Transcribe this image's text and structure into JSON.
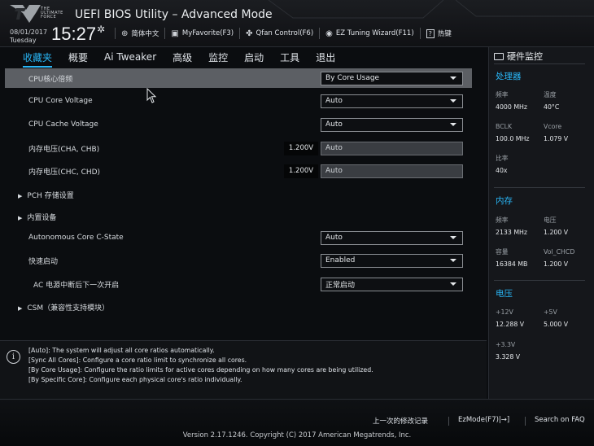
{
  "header": {
    "logo_text": "THE ULTIMATE FORCE",
    "title": "UEFI BIOS Utility – Advanced Mode",
    "date": "08/01/2017",
    "day": "Tuesday",
    "time": "15:27",
    "tools": [
      {
        "icon": "globe-icon",
        "label": "简体中文"
      },
      {
        "icon": "star-icon",
        "label": "MyFavorite(F3)"
      },
      {
        "icon": "fan-icon",
        "label": "Qfan Control(F6)"
      },
      {
        "icon": "bulb-icon",
        "label": "EZ Tuning Wizard(F11)"
      },
      {
        "icon": "question-icon",
        "label": "热键"
      }
    ]
  },
  "tabs": [
    "收藏夹",
    "概要",
    "Ai Tweaker",
    "高级",
    "监控",
    "启动",
    "工具",
    "退出"
  ],
  "active_tab": 0,
  "settings": {
    "cpu_ratio": {
      "label": "CPU核心倍频",
      "value": "By Core Usage"
    },
    "cpu_core_voltage": {
      "label": "CPU Core Voltage",
      "value": "Auto"
    },
    "cpu_cache_voltage": {
      "label": "CPU Cache Voltage",
      "value": "Auto"
    },
    "dram_ab": {
      "label": "内存电压(CHA, CHB)",
      "reading": "1.200V",
      "value": "Auto"
    },
    "dram_cd": {
      "label": "内存电压(CHC, CHD)",
      "reading": "1.200V",
      "value": "Auto"
    },
    "pch": {
      "label": "PCH 存储设置"
    },
    "onboard": {
      "label": "内置设备"
    },
    "c_state": {
      "label": "Autonomous Core C-State",
      "value": "Auto"
    },
    "fast_boot": {
      "label": "快速启动",
      "value": "Enabled"
    },
    "ac_power": {
      "label": "AC 电源中断后下一次开启",
      "value": "正常启动"
    },
    "csm": {
      "label": "CSM（兼容性支持模块）"
    }
  },
  "help": [
    "[Auto]: The system will adjust all core ratios automatically.",
    "[Sync All Cores]: Configure a core ratio limit to synchronize all cores.",
    "[By Core Usage]: Configure the ratio limits for active cores depending on how many cores are being utilized.",
    "[By Specific Core]: Configure each physical core's ratio individually."
  ],
  "hw_monitor": {
    "title": "硬件监控",
    "cpu": {
      "title": "处理器",
      "freq_label": "频率",
      "freq": "4000 MHz",
      "temp_label": "温度",
      "temp": "40°C",
      "bclk_label": "BCLK",
      "bclk": "100.0 MHz",
      "vcore_label": "Vcore",
      "vcore": "1.079 V",
      "ratio_label": "比率",
      "ratio": "40x"
    },
    "memory": {
      "title": "内存",
      "freq_label": "频率",
      "freq": "2133 MHz",
      "volt_label": "电压",
      "volt": "1.200 V",
      "cap_label": "容量",
      "cap": "16384 MB",
      "volchcd_label": "Vol_CHCD",
      "volchcd": "1.200 V"
    },
    "voltage": {
      "title": "电压",
      "v12_label": "+12V",
      "v12": "12.288 V",
      "v5_label": "+5V",
      "v5": "5.000 V",
      "v33_label": "+3.3V",
      "v33": "3.328 V"
    }
  },
  "footer": {
    "last_change": "上一次的修改记录",
    "ezmode": "EzMode(F7)|→]",
    "faq": "Search on FAQ",
    "version": "Version 2.17.1246. Copyright (C) 2017 American Megatrends, Inc."
  },
  "colors": {
    "accent": "#29b6f6",
    "selected_row": "#5c5f64"
  }
}
